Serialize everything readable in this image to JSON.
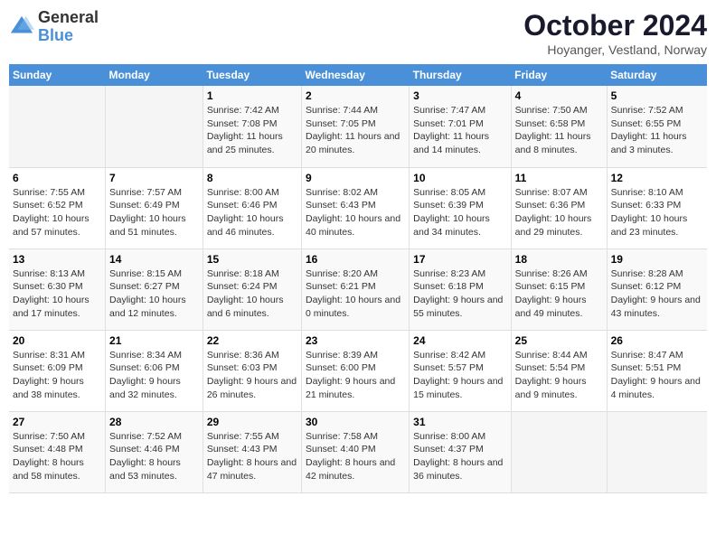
{
  "logo": {
    "line1": "General",
    "line2": "Blue"
  },
  "title": "October 2024",
  "subtitle": "Hoyanger, Vestland, Norway",
  "days_of_week": [
    "Sunday",
    "Monday",
    "Tuesday",
    "Wednesday",
    "Thursday",
    "Friday",
    "Saturday"
  ],
  "weeks": [
    [
      {
        "day": "",
        "empty": true
      },
      {
        "day": "",
        "empty": true
      },
      {
        "day": "1",
        "sunrise": "Sunrise: 7:42 AM",
        "sunset": "Sunset: 7:08 PM",
        "daylight": "Daylight: 11 hours and 25 minutes."
      },
      {
        "day": "2",
        "sunrise": "Sunrise: 7:44 AM",
        "sunset": "Sunset: 7:05 PM",
        "daylight": "Daylight: 11 hours and 20 minutes."
      },
      {
        "day": "3",
        "sunrise": "Sunrise: 7:47 AM",
        "sunset": "Sunset: 7:01 PM",
        "daylight": "Daylight: 11 hours and 14 minutes."
      },
      {
        "day": "4",
        "sunrise": "Sunrise: 7:50 AM",
        "sunset": "Sunset: 6:58 PM",
        "daylight": "Daylight: 11 hours and 8 minutes."
      },
      {
        "day": "5",
        "sunrise": "Sunrise: 7:52 AM",
        "sunset": "Sunset: 6:55 PM",
        "daylight": "Daylight: 11 hours and 3 minutes."
      }
    ],
    [
      {
        "day": "6",
        "sunrise": "Sunrise: 7:55 AM",
        "sunset": "Sunset: 6:52 PM",
        "daylight": "Daylight: 10 hours and 57 minutes."
      },
      {
        "day": "7",
        "sunrise": "Sunrise: 7:57 AM",
        "sunset": "Sunset: 6:49 PM",
        "daylight": "Daylight: 10 hours and 51 minutes."
      },
      {
        "day": "8",
        "sunrise": "Sunrise: 8:00 AM",
        "sunset": "Sunset: 6:46 PM",
        "daylight": "Daylight: 10 hours and 46 minutes."
      },
      {
        "day": "9",
        "sunrise": "Sunrise: 8:02 AM",
        "sunset": "Sunset: 6:43 PM",
        "daylight": "Daylight: 10 hours and 40 minutes."
      },
      {
        "day": "10",
        "sunrise": "Sunrise: 8:05 AM",
        "sunset": "Sunset: 6:39 PM",
        "daylight": "Daylight: 10 hours and 34 minutes."
      },
      {
        "day": "11",
        "sunrise": "Sunrise: 8:07 AM",
        "sunset": "Sunset: 6:36 PM",
        "daylight": "Daylight: 10 hours and 29 minutes."
      },
      {
        "day": "12",
        "sunrise": "Sunrise: 8:10 AM",
        "sunset": "Sunset: 6:33 PM",
        "daylight": "Daylight: 10 hours and 23 minutes."
      }
    ],
    [
      {
        "day": "13",
        "sunrise": "Sunrise: 8:13 AM",
        "sunset": "Sunset: 6:30 PM",
        "daylight": "Daylight: 10 hours and 17 minutes."
      },
      {
        "day": "14",
        "sunrise": "Sunrise: 8:15 AM",
        "sunset": "Sunset: 6:27 PM",
        "daylight": "Daylight: 10 hours and 12 minutes."
      },
      {
        "day": "15",
        "sunrise": "Sunrise: 8:18 AM",
        "sunset": "Sunset: 6:24 PM",
        "daylight": "Daylight: 10 hours and 6 minutes."
      },
      {
        "day": "16",
        "sunrise": "Sunrise: 8:20 AM",
        "sunset": "Sunset: 6:21 PM",
        "daylight": "Daylight: 10 hours and 0 minutes."
      },
      {
        "day": "17",
        "sunrise": "Sunrise: 8:23 AM",
        "sunset": "Sunset: 6:18 PM",
        "daylight": "Daylight: 9 hours and 55 minutes."
      },
      {
        "day": "18",
        "sunrise": "Sunrise: 8:26 AM",
        "sunset": "Sunset: 6:15 PM",
        "daylight": "Daylight: 9 hours and 49 minutes."
      },
      {
        "day": "19",
        "sunrise": "Sunrise: 8:28 AM",
        "sunset": "Sunset: 6:12 PM",
        "daylight": "Daylight: 9 hours and 43 minutes."
      }
    ],
    [
      {
        "day": "20",
        "sunrise": "Sunrise: 8:31 AM",
        "sunset": "Sunset: 6:09 PM",
        "daylight": "Daylight: 9 hours and 38 minutes."
      },
      {
        "day": "21",
        "sunrise": "Sunrise: 8:34 AM",
        "sunset": "Sunset: 6:06 PM",
        "daylight": "Daylight: 9 hours and 32 minutes."
      },
      {
        "day": "22",
        "sunrise": "Sunrise: 8:36 AM",
        "sunset": "Sunset: 6:03 PM",
        "daylight": "Daylight: 9 hours and 26 minutes."
      },
      {
        "day": "23",
        "sunrise": "Sunrise: 8:39 AM",
        "sunset": "Sunset: 6:00 PM",
        "daylight": "Daylight: 9 hours and 21 minutes."
      },
      {
        "day": "24",
        "sunrise": "Sunrise: 8:42 AM",
        "sunset": "Sunset: 5:57 PM",
        "daylight": "Daylight: 9 hours and 15 minutes."
      },
      {
        "day": "25",
        "sunrise": "Sunrise: 8:44 AM",
        "sunset": "Sunset: 5:54 PM",
        "daylight": "Daylight: 9 hours and 9 minutes."
      },
      {
        "day": "26",
        "sunrise": "Sunrise: 8:47 AM",
        "sunset": "Sunset: 5:51 PM",
        "daylight": "Daylight: 9 hours and 4 minutes."
      }
    ],
    [
      {
        "day": "27",
        "sunrise": "Sunrise: 7:50 AM",
        "sunset": "Sunset: 4:48 PM",
        "daylight": "Daylight: 8 hours and 58 minutes."
      },
      {
        "day": "28",
        "sunrise": "Sunrise: 7:52 AM",
        "sunset": "Sunset: 4:46 PM",
        "daylight": "Daylight: 8 hours and 53 minutes."
      },
      {
        "day": "29",
        "sunrise": "Sunrise: 7:55 AM",
        "sunset": "Sunset: 4:43 PM",
        "daylight": "Daylight: 8 hours and 47 minutes."
      },
      {
        "day": "30",
        "sunrise": "Sunrise: 7:58 AM",
        "sunset": "Sunset: 4:40 PM",
        "daylight": "Daylight: 8 hours and 42 minutes."
      },
      {
        "day": "31",
        "sunrise": "Sunrise: 8:00 AM",
        "sunset": "Sunset: 4:37 PM",
        "daylight": "Daylight: 8 hours and 36 minutes."
      },
      {
        "day": "",
        "empty": true
      },
      {
        "day": "",
        "empty": true
      }
    ]
  ]
}
